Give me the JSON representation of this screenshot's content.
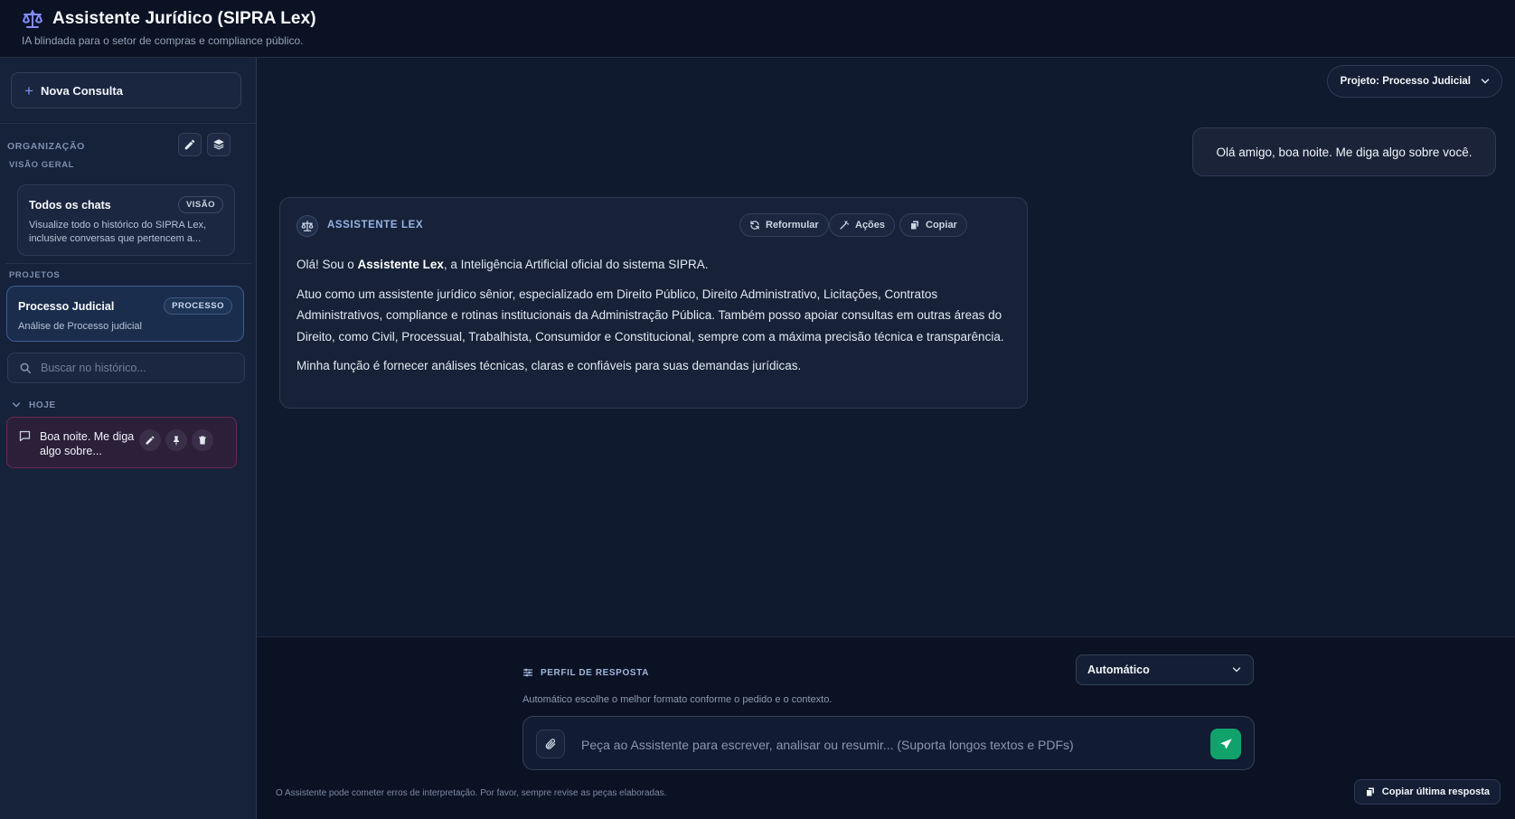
{
  "header": {
    "title": "Assistente Jurídico (SIPRA Lex)",
    "subtitle": "IA blindada para o setor de compras e compliance público.",
    "logo_icon": "scale-balance-icon"
  },
  "sidebar": {
    "new_chat_label": "Nova Consulta",
    "organization_label": "ORGANIZAÇÃO",
    "overview_label": "VISÃO GERAL",
    "all_chats": {
      "title": "Todos os chats",
      "badge": "VISÃO",
      "description": "Visualize todo o histórico do SIPRA Lex, inclusive conversas que pertencem a..."
    },
    "projects_label": "PROJETOS",
    "project": {
      "title": "Processo Judicial",
      "badge": "PROCESSO",
      "description": "Análise de Processo judicial"
    },
    "search_placeholder": "Buscar no histórico...",
    "today_label": "HOJE",
    "chat_items": [
      {
        "title": "Boa noite. Me diga algo sobre..."
      }
    ]
  },
  "main": {
    "project_selector": "Projeto: Processo Judicial",
    "user_message": "Olá amigo, boa noite. Me diga algo sobre você.",
    "assistant": {
      "name": "ASSISTENTE LEX",
      "actions": [
        "Reformular",
        "Ações",
        "Copiar"
      ],
      "p1_before": "Olá! Sou o ",
      "p1_bold": "Assistente Lex",
      "p1_after": ", a Inteligência Artificial oficial do sistema SIPRA.",
      "p2": "Atuo como um assistente jurídico sênior, especializado em Direito Público, Direito Administrativo, Licitações, Contratos Administrativos, compliance e rotinas institucionais da Administração Pública. Também posso apoiar consultas em outras áreas do Direito, como Civil, Processual, Trabalhista, Consumidor e Constitucional, sempre com a máxima precisão técnica e transparência.",
      "p3": "Minha função é fornecer análises técnicas, claras e confiáveis para suas demandas jurídicas."
    }
  },
  "composer": {
    "profile_label": "PERFIL DE RESPOSTA",
    "profile_value": "Automático",
    "profile_hint": "Automático escolhe o melhor formato conforme o pedido e o contexto.",
    "input_placeholder": "Peça ao Assistente para escrever, analisar ou resumir... (Suporta longos textos e PDFs)",
    "disclaimer": "O Assistente pode cometer erros de interpretação. Por favor, sempre revise as peças elaboradas.",
    "copy_last_label": "Copiar última resposta"
  },
  "colors": {
    "accent": "#818cf8",
    "send": "#10a26a",
    "background": "#0f172a"
  }
}
